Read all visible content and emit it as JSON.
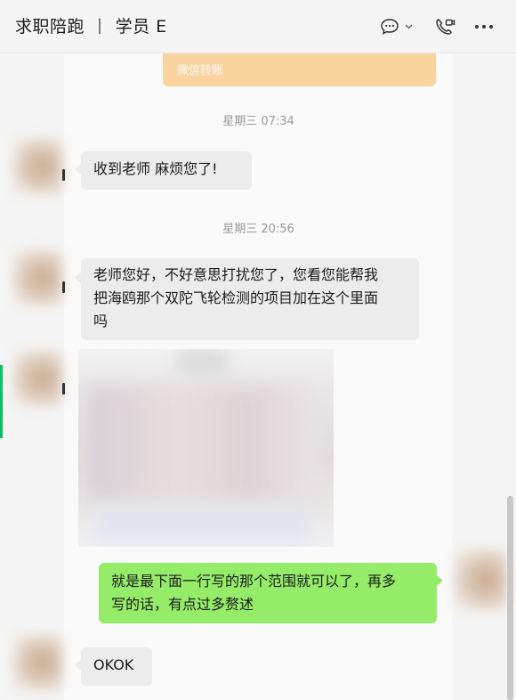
{
  "header": {
    "title": "求职陪跑",
    "separator": "|",
    "subtitle": "学员 E",
    "icons": [
      "chat-bubble-icon",
      "chevron-down-icon",
      "phone-video-icon",
      "more-icon"
    ]
  },
  "messages": {
    "transfer_label": "微信转账",
    "ts1": "星期三 07:34",
    "msg1": "收到老师 麻烦您了!",
    "ts2": "星期三 20:56",
    "msg2_line1": "老师您好，不好意思打扰您了，您看您能帮我",
    "msg2_line2": "把海鸥那个双陀飞轮检测的项目加在这个里面",
    "msg2_line3": "吗",
    "msg3_line1": "就是最下面一行写的那个范围就可以了，再多",
    "msg3_line2": "写的话，有点过多赘述",
    "msg4": "OKOK"
  },
  "colors": {
    "accent": "#07c160",
    "outgoing_bubble": "#95ec69",
    "incoming_bubble": "#ececec",
    "transfer_card": "#fbd39f"
  }
}
